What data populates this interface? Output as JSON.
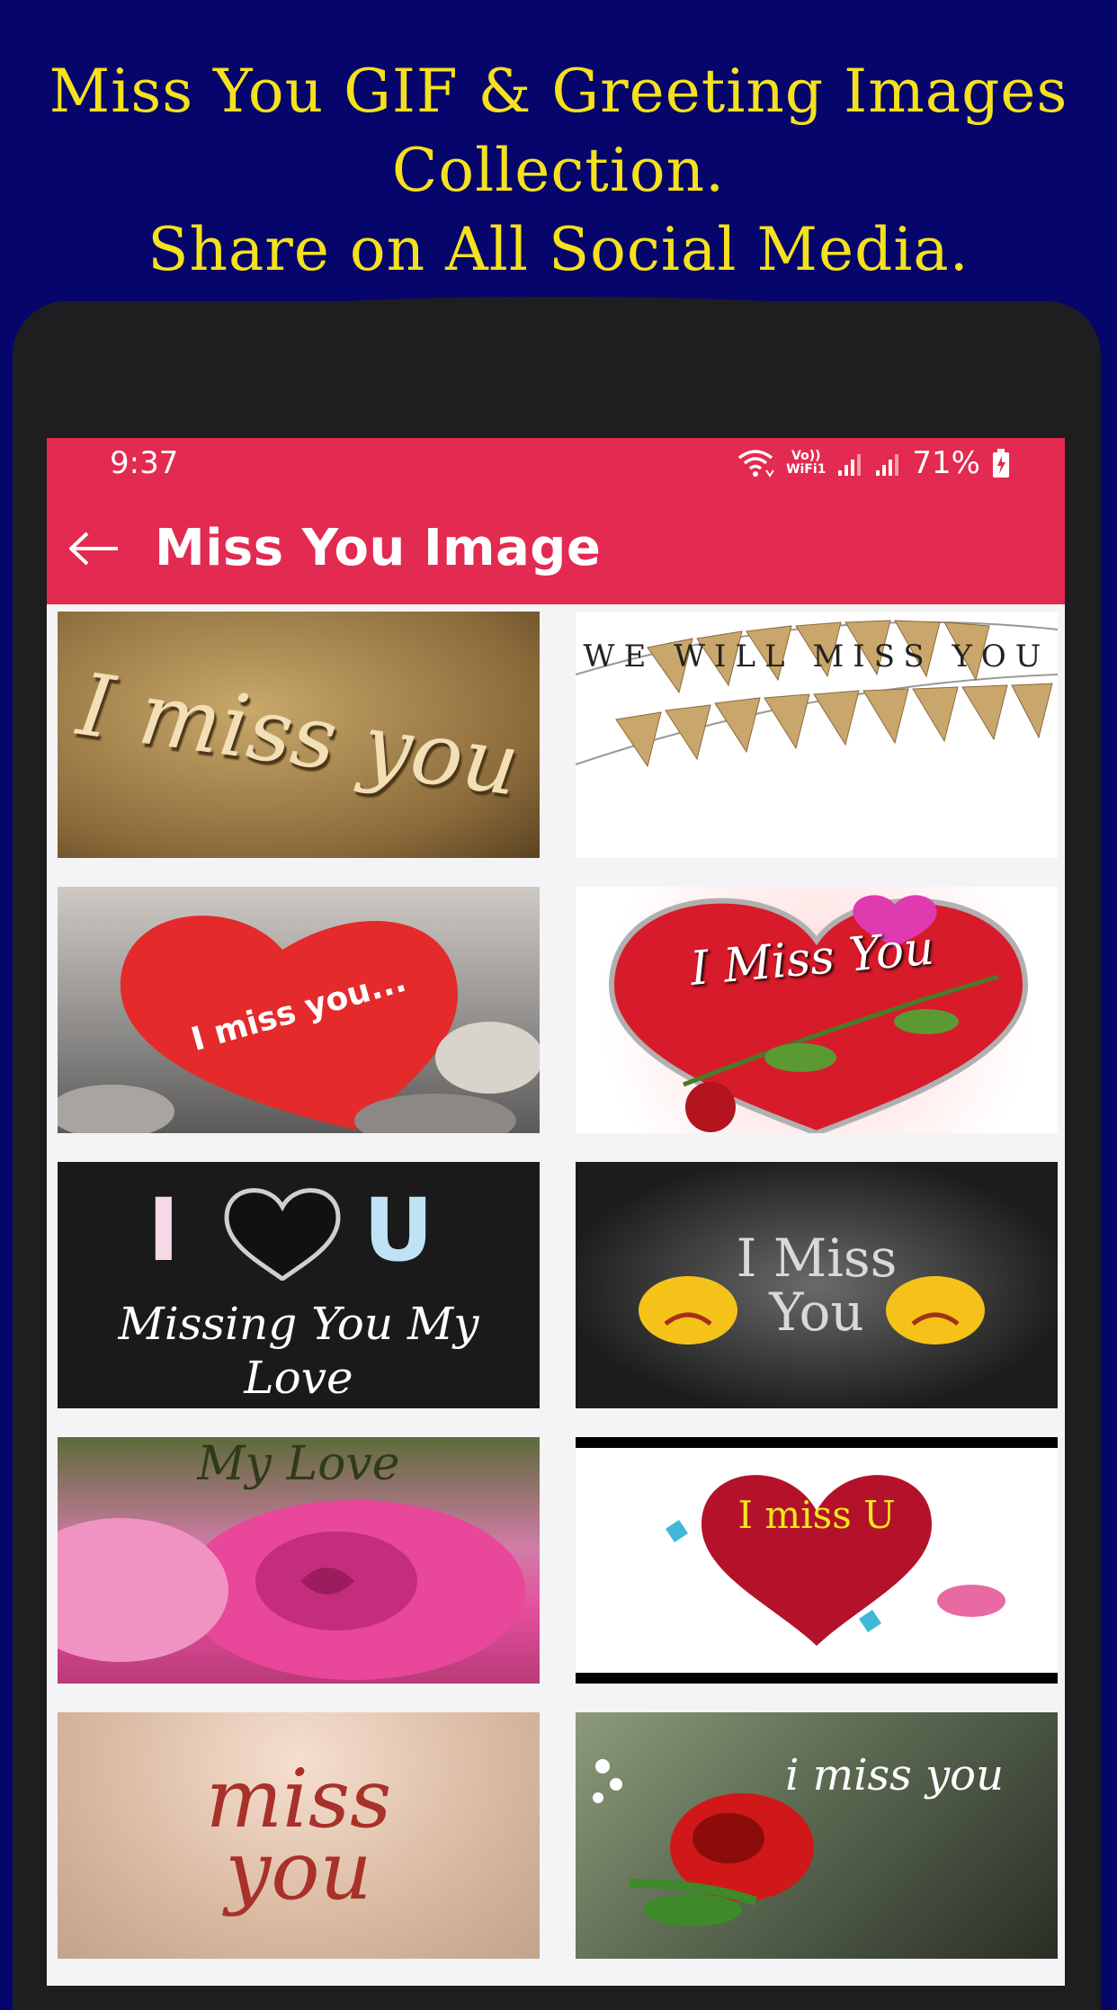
{
  "promo": {
    "line1": "Miss You GIF & Greeting Images",
    "line2": "Collection.",
    "line3": "Share on All Social Media."
  },
  "status_bar": {
    "time": "9:37",
    "vo_label_top": "Vo))",
    "vo_label_bottom": "WiFi1",
    "battery": "71%"
  },
  "app_bar": {
    "title": "Miss You Image",
    "back_icon": "arrow-left-icon"
  },
  "colors": {
    "background": "#06056b",
    "promo_text": "#f5e11c",
    "app_bar": "#e32a50",
    "phone_frame": "#1e1e21"
  },
  "tiles": [
    {
      "caption": "I miss you"
    },
    {
      "caption": "WE WILL MISS YOU"
    },
    {
      "caption": "I miss you..."
    },
    {
      "caption": "I Miss You"
    },
    {
      "caption_top": "I",
      "caption_top_right": "U",
      "caption": "Missing You My Love"
    },
    {
      "caption": "I Miss You"
    },
    {
      "caption": "My Love"
    },
    {
      "caption": "I miss U"
    },
    {
      "caption": "miss you"
    },
    {
      "caption": "i miss you"
    }
  ]
}
